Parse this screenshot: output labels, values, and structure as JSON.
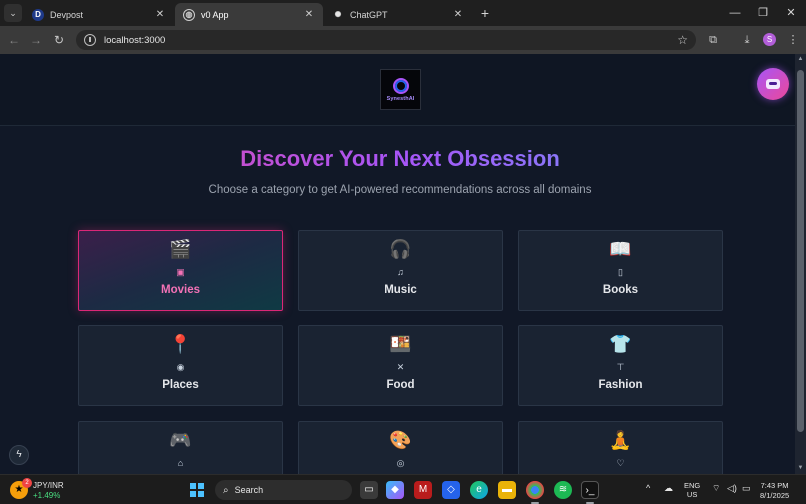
{
  "browser": {
    "tabs": [
      {
        "title": "Devpost",
        "favicon": "D",
        "active": false
      },
      {
        "title": "v0 App",
        "favicon": "globe-icon",
        "active": true
      },
      {
        "title": "ChatGPT",
        "favicon": "chatgpt-icon",
        "active": false
      }
    ],
    "url": "localhost:3000",
    "profile_initial": "S"
  },
  "site": {
    "logo_text": "SynesthAI",
    "hero_title": "Discover Your Next Obsession",
    "hero_subtitle": "Choose a category to get AI-powered recommendations across all domains",
    "accent_pink": "#ec4899",
    "accent_purple": "#a855f7",
    "categories": [
      {
        "label": "Movies",
        "emoji": "🎬",
        "small_icon": "▣",
        "icon": "film-icon",
        "selected": true
      },
      {
        "label": "Music",
        "emoji": "🎧",
        "small_icon": "♫",
        "icon": "music-note-icon",
        "selected": false
      },
      {
        "label": "Books",
        "emoji": "📖",
        "small_icon": "▯",
        "icon": "book-icon",
        "selected": false
      },
      {
        "label": "Places",
        "emoji": "📍",
        "small_icon": "◉",
        "icon": "map-pin-icon",
        "selected": false
      },
      {
        "label": "Food",
        "emoji": "🍱",
        "small_icon": "✕",
        "icon": "utensils-icon",
        "selected": false
      },
      {
        "label": "Fashion",
        "emoji": "👕",
        "small_icon": "⊤",
        "icon": "shirt-icon",
        "selected": false
      },
      {
        "label": "",
        "emoji": "🎮",
        "small_icon": "⌂",
        "icon": "gamepad-icon",
        "selected": false
      },
      {
        "label": "",
        "emoji": "🎨",
        "small_icon": "◎",
        "icon": "palette-icon",
        "selected": false
      },
      {
        "label": "",
        "emoji": "🧘",
        "small_icon": "♡",
        "icon": "heart-icon",
        "selected": false
      }
    ]
  },
  "taskbar": {
    "ticker_name": "JPY/INR",
    "ticker_change": "+1.49%",
    "ticker_badge": "2",
    "search_placeholder": "Search",
    "lang_line1": "ENG",
    "lang_line2": "US",
    "time": "7:43 PM",
    "date": "8/1/2025"
  }
}
